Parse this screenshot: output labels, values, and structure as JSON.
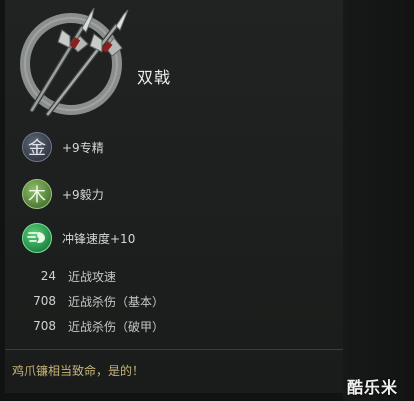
{
  "item": {
    "name": "双戟"
  },
  "attributes": [
    {
      "badge": "金",
      "text": "+9专精",
      "icon": "metal-element-icon"
    },
    {
      "badge": "木",
      "text": "+9毅力",
      "icon": "wood-element-icon"
    },
    {
      "badge": "",
      "text": "冲锋速度+10",
      "icon": "charge-speed-icon"
    }
  ],
  "stats": [
    {
      "value": "24",
      "label": "近战攻速"
    },
    {
      "value": "708",
      "label": "近战杀伤（基本）"
    },
    {
      "value": "708",
      "label": "近战杀伤（破甲）"
    }
  ],
  "flavor_text": "鸡爪镰相当致命，是的！",
  "watermark": "酷乐米",
  "colors": {
    "panel": "#202322",
    "flavor": "#c9b37a",
    "metal_badge": "#3a404b",
    "wood_badge": "#5a8a3e",
    "charge_badge": "#23964c"
  }
}
